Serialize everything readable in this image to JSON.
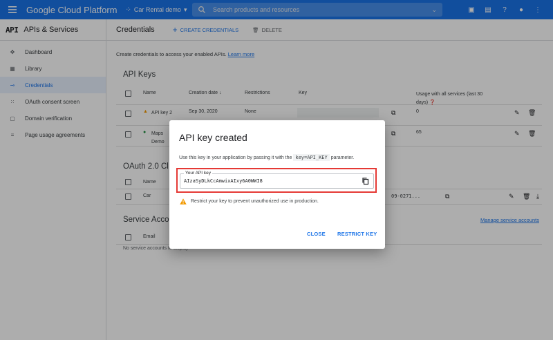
{
  "topbar": {
    "brand": "Google Cloud Platform",
    "project": "Car Rental demo",
    "search_placeholder": "Search products and resources"
  },
  "sidebar": {
    "title": "APIs & Services",
    "logo": "API",
    "items": [
      {
        "label": "Dashboard",
        "icon": "dashboard-icon"
      },
      {
        "label": "Library",
        "icon": "library-icon"
      },
      {
        "label": "Credentials",
        "icon": "key-icon"
      },
      {
        "label": "OAuth consent screen",
        "icon": "oauth-icon"
      },
      {
        "label": "Domain verification",
        "icon": "domain-icon"
      },
      {
        "label": "Page usage agreements",
        "icon": "settings-list-icon"
      }
    ]
  },
  "main": {
    "title": "Credentials",
    "create_label": "CREATE CREDENTIALS",
    "delete_label": "DELETE",
    "intro": "Create credentials to access your enabled APIs.",
    "learn_more": "Learn more",
    "api_keys": {
      "title": "API Keys",
      "headers": {
        "name": "Name",
        "created": "Creation date",
        "restrictions": "Restrictions",
        "key": "Key",
        "usage": "Usage with all services (last 30 days)"
      },
      "rows": [
        {
          "name": "API key 2",
          "created": "Sep 30, 2020",
          "restrictions": "None",
          "usage": "0"
        },
        {
          "name": "Maps Demo",
          "usage": "65"
        }
      ]
    },
    "oauth": {
      "title": "OAuth 2.0 Cl",
      "header_name": "Name",
      "row_name": "Car",
      "row_key": "09-0271..."
    },
    "service": {
      "title": "Service Acco",
      "header_email": "Email",
      "manage_link": "Manage service accounts",
      "empty": "No service accounts to display"
    }
  },
  "dialog": {
    "title": "API key created",
    "desc_before": "Use this key in your application by passing it with the",
    "desc_code": "key=API_KEY",
    "desc_after": "parameter.",
    "field_label": "Your API key",
    "api_key": "AIzaSyDLkCcAmwixAIxy6A0WWI8",
    "warning": "Restrict your key to prevent unauthorized use in production.",
    "close_label": "CLOSE",
    "restrict_label": "RESTRICT KEY"
  },
  "colors": {
    "primary": "#1a73e8",
    "highlight": "#e53935",
    "warning": "#f29900",
    "success": "#1e8e3e"
  }
}
